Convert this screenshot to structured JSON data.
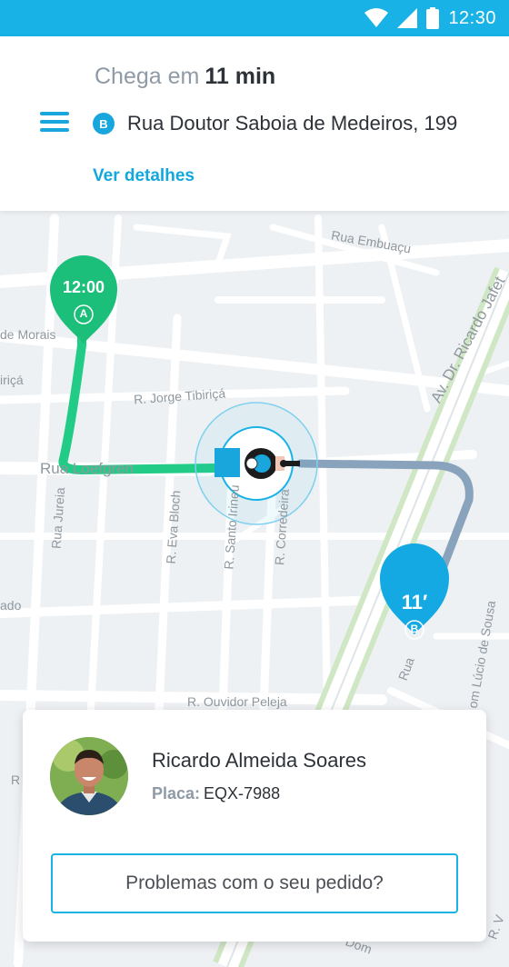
{
  "status": {
    "time": "12:30"
  },
  "header": {
    "eta_label": "Chega em",
    "eta_value": "11 min",
    "dest_badge": "B",
    "destination": "Rua Doutor Saboia de Medeiros, 199",
    "details_link": "Ver detalhes"
  },
  "map": {
    "streets": {
      "embuacu": "Rua Embuaçu",
      "ricardo_jafet": "Av. Dr. Ricardo Jafet",
      "morais": "de Morais",
      "tibirica_left": "iriçá",
      "jorge_tibirica": "R. Jorge Tibiriçá",
      "leefgren": "Rua Loefgren",
      "jureia": "Rua Jureia",
      "eva_bloch": "R. Eva Bloch",
      "santo_irineu": "R. Santo Irineu",
      "correde": "R. Corredeira",
      "ado": "ado",
      "ouvidor": "R. Ouvidor Peleja",
      "lucio": "om Lúcio de Sousa",
      "rua_b": "Rua",
      "r_left": "R",
      "dom": "Dom",
      "v": "R. V"
    },
    "pin_a": {
      "time": "12:00",
      "letter": "A"
    },
    "pin_b": {
      "time": "11′",
      "letter": "B"
    },
    "colors": {
      "traveled": "#23cc86",
      "remaining": "#8aa3bc",
      "pin_a": "#1bbf7a",
      "pin_b": "#14a9e2"
    }
  },
  "driver": {
    "name": "Ricardo Almeida Soares",
    "plate_label": "Placa:",
    "plate": "EQX-7988",
    "problem_button": "Problemas com o seu pedido?"
  }
}
